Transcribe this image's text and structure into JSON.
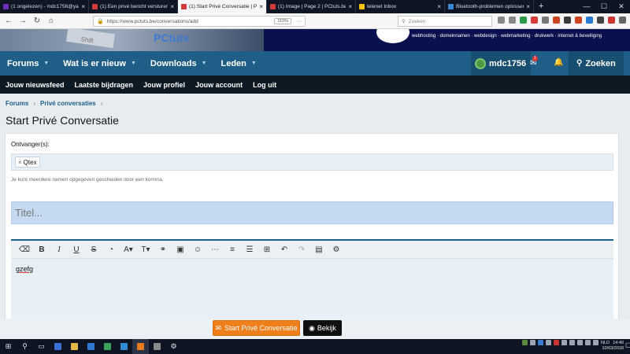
{
  "browser": {
    "tabs": [
      {
        "label": "(1 ongelezen) - mdc1756@yahoo.",
        "color": "#6f2eb8",
        "active": false
      },
      {
        "label": "(1) Een privé bericht versturen",
        "color": "#d33b3b",
        "active": false
      },
      {
        "label": "(1) Start Privé Conversatie | PC-H",
        "color": "#d33b3b",
        "active": true
      },
      {
        "label": "(1) Image | Page 2 | PCtuts.be",
        "color": "#d33b3b",
        "active": false
      },
      {
        "label": "telenet Inbox",
        "color": "#f4c400",
        "active": false
      },
      {
        "label": "Bluetooth-problemen oplossen",
        "color": "#3a86d3",
        "active": false
      }
    ],
    "url": "https://www.pctuts.be/conversations/add",
    "zoom": "110%",
    "search_placeholder": "Zoeken",
    "window_controls": [
      "—",
      "☐",
      "✕"
    ]
  },
  "banner": {
    "key_label": "Shift",
    "brand_text": "PCtuts",
    "tagline": "webhosting · domeinnamen · webdesign · webmarketing · drukwerk · internet & beveiliging"
  },
  "mainnav": {
    "items": [
      {
        "label": "Forums"
      },
      {
        "label": "Wat is er nieuw"
      },
      {
        "label": "Downloads"
      },
      {
        "label": "Leden"
      }
    ],
    "username": "mdc1756",
    "mail_badge": "1",
    "search_label": "Zoeken"
  },
  "subnav": {
    "items": [
      "Jouw nieuwsfeed",
      "Laatste bijdragen",
      "Jouw profiel",
      "Jouw account",
      "Log uit"
    ]
  },
  "page": {
    "breadcrumb": [
      "Forums",
      "Privé conversaties"
    ],
    "title": "Start Privé Conversatie",
    "recipients_label": "Ontvanger(s):",
    "recipient_token": "Qtex",
    "hint": "Je kunt meerdere namen opgegeven gescheiden door een komma.",
    "title_placeholder": "Titel...",
    "editor_text": "gzefg",
    "submit_label": "Start Privé Conversatie",
    "preview_label": "Bekijk"
  },
  "taskbar": {
    "lang": "NLD",
    "time": "14:40",
    "date": "10/03/2018"
  },
  "colors": {
    "nav_blue": "#1f5e86",
    "subnav_dark": "#0d1a24",
    "submit_orange": "#ee7f1b",
    "title_input_bg": "#c5daf0"
  }
}
